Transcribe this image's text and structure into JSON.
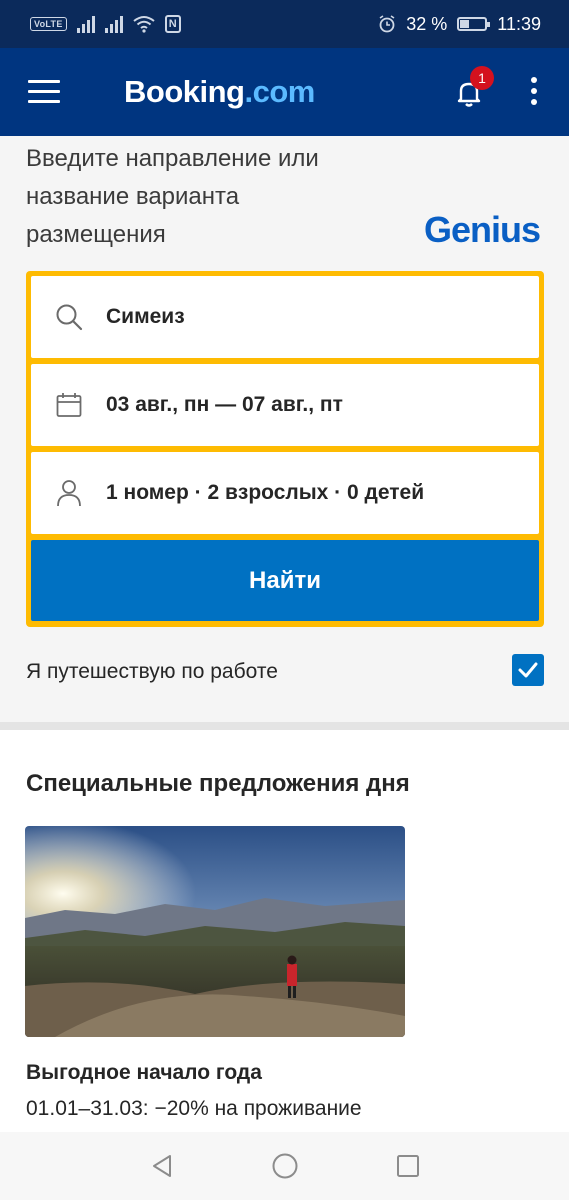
{
  "status_bar": {
    "volte": "VoLTE",
    "battery_percent": "32 %",
    "battery_level": 0.32,
    "time": "11:39",
    "nfc": "N"
  },
  "app_bar": {
    "logo_main": "Booking",
    "logo_suffix": ".com",
    "notification_count": "1"
  },
  "search": {
    "heading": "Введите направление или название варианта размещения",
    "genius_label": "Genius",
    "destination": "Симеиз",
    "dates": "03 авг., пн — 07 авг., пт",
    "guests": "1 номер · 2 взрослых · 0 детей",
    "search_button": "Найти",
    "business_trip_label": "Я путешествую по работе",
    "business_trip_checked": true
  },
  "deals": {
    "title": "Специальные предложения дня",
    "items": [
      {
        "name": "Выгодное начало года",
        "description": "01.01–31.03: −20% на проживание"
      }
    ]
  },
  "colors": {
    "status_bar": "#0b2a5b",
    "app_bar": "#003580",
    "form_border": "#febb02",
    "primary_button": "#0071c2",
    "badge": "#d4111e"
  }
}
